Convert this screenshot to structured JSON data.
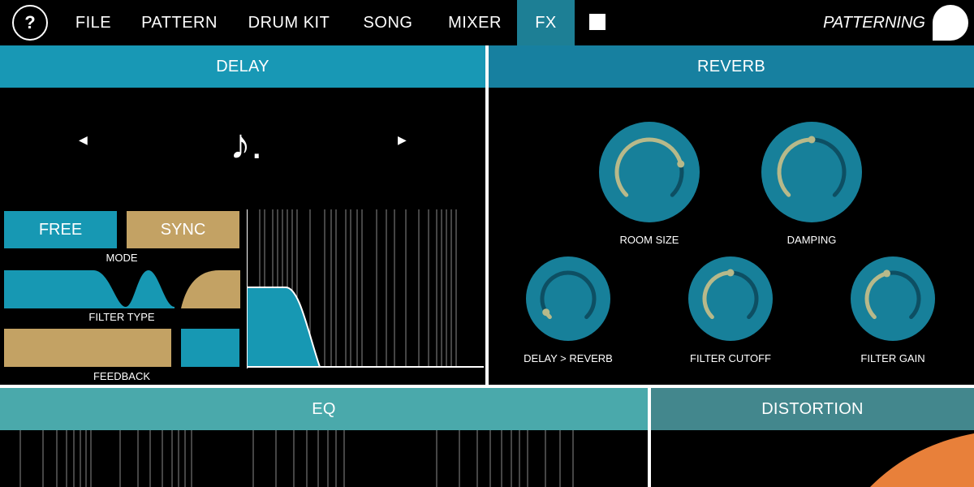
{
  "nav": {
    "help_label": "?",
    "items": [
      {
        "label": "FILE"
      },
      {
        "label": "PATTERN"
      },
      {
        "label": "DRUM KIT"
      },
      {
        "label": "SONG"
      },
      {
        "label": "MIXER"
      },
      {
        "label": "FX",
        "active": true
      }
    ],
    "brand": "PATTERNING"
  },
  "delay": {
    "title": "DELAY",
    "note_glyph": "♪.",
    "prev_glyph": "◀",
    "next_glyph": "▶",
    "mode_options": [
      "FREE",
      "SYNC"
    ],
    "mode_selected": "FREE",
    "mode_label": "MODE",
    "filter_type_label": "FILTER TYPE",
    "feedback_label": "FEEDBACK"
  },
  "reverb": {
    "title": "REVERB",
    "knobs": [
      {
        "label": "ROOM SIZE",
        "value": 0.78
      },
      {
        "label": "DAMPING",
        "value": 0.5
      },
      {
        "label": "DELAY > REVERB",
        "value": 0.05
      },
      {
        "label": "FILTER CUTOFF",
        "value": 0.5
      },
      {
        "label": "FILTER GAIN",
        "value": 0.45
      }
    ]
  },
  "eq": {
    "title": "EQ"
  },
  "distortion": {
    "title": "DISTORTION"
  },
  "colors": {
    "teal": "#1798b3",
    "gold": "#c3a264",
    "knob": "#17809a",
    "arc_on": "#b7b98a",
    "arc_off": "#0d4f63",
    "orange": "#e8803a"
  }
}
